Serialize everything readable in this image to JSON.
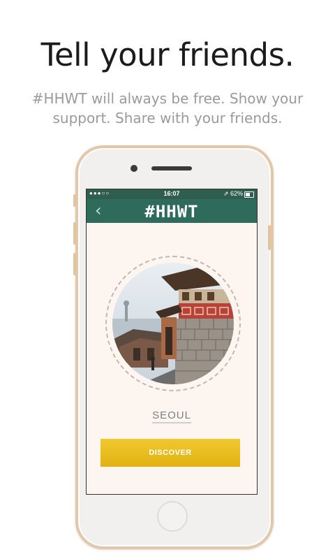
{
  "headline": "Tell your friends.",
  "subline_1": "#HHWT will always be free. Show your",
  "subline_2": "support. Share with your friends.",
  "status_bar": {
    "signal": "●●●○○",
    "time": "16:07",
    "battery_text": "⇗ 62%"
  },
  "app": {
    "title": "#HHWT",
    "back_icon": "chevron-left-icon",
    "city": "SEOUL",
    "discover_label": "DISCOVER"
  },
  "colors": {
    "nav_green": "#2f6b5a",
    "button_yellow": "#e9bd1c",
    "screen_bg": "#fdf5f0"
  }
}
